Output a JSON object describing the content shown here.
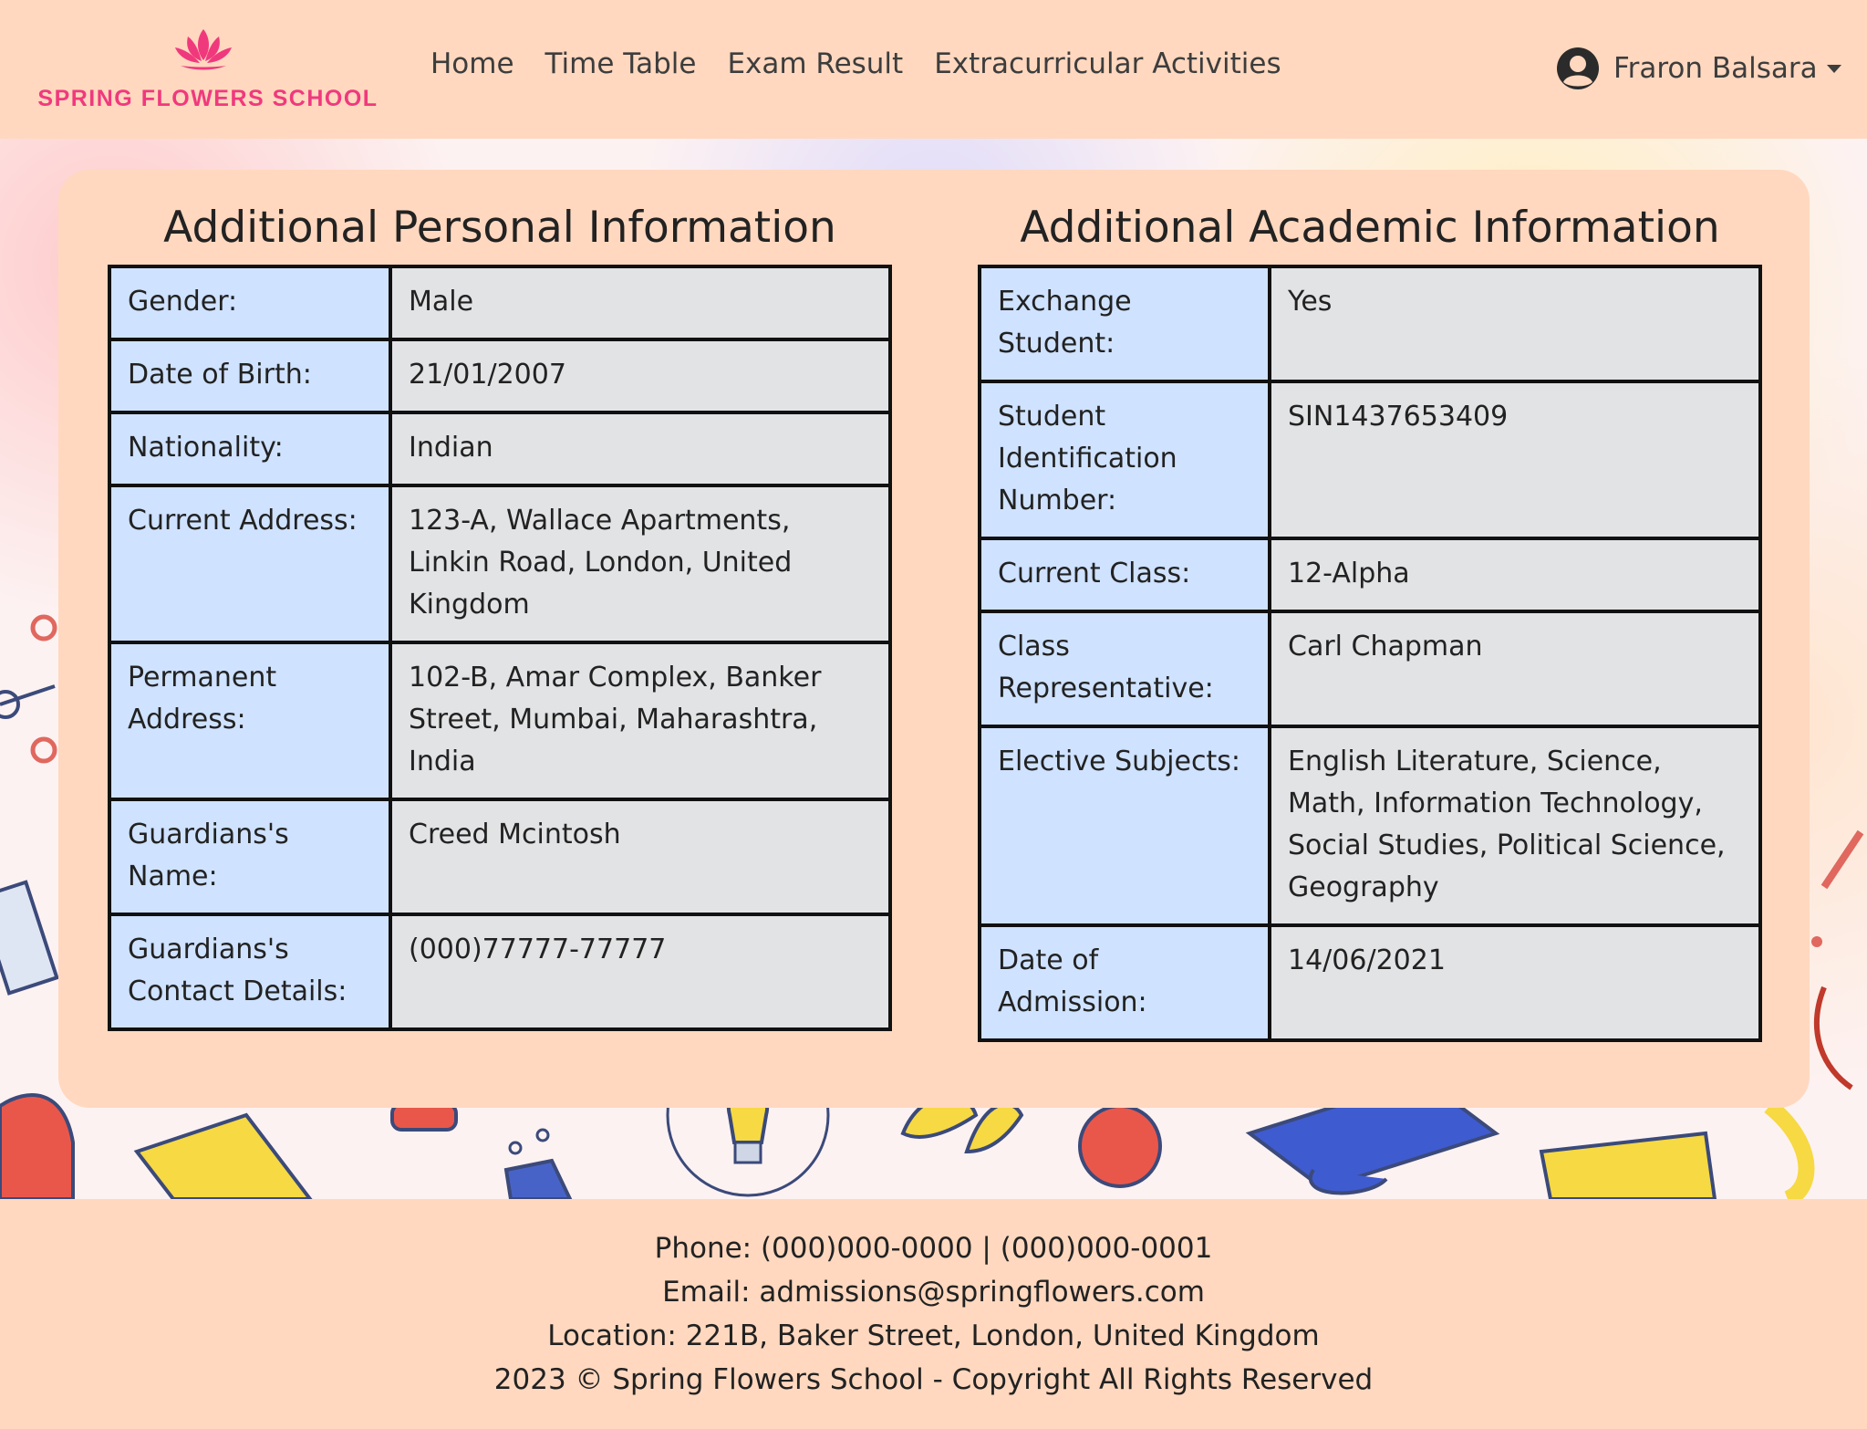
{
  "brand": {
    "name": "SPRING FLOWERS SCHOOL",
    "logo_icon": "lotus-icon",
    "color": "#f0397d"
  },
  "nav": {
    "items": [
      "Home",
      "Time Table",
      "Exam Result",
      "Extracurricular Activities"
    ]
  },
  "user": {
    "name": "Fraron Balsara",
    "icon": "user-avatar-icon"
  },
  "personal": {
    "title": "Additional Personal Information",
    "rows": [
      {
        "label": "Gender:",
        "value": "Male"
      },
      {
        "label": "Date of Birth:",
        "value": "21/01/2007"
      },
      {
        "label": "Nationality:",
        "value": "Indian"
      },
      {
        "label": "Current Address:",
        "value": "123-A, Wallace Apartments, Linkin Road, London, United Kingdom"
      },
      {
        "label": "Permanent Address:",
        "value": "102-B, Amar Complex, Banker Street, Mumbai, Maharashtra, India"
      },
      {
        "label": "Guardians's Name:",
        "value": "Creed Mcintosh"
      },
      {
        "label": "Guardians's Contact Details:",
        "value": "(000)77777-77777"
      }
    ]
  },
  "academic": {
    "title": "Additional Academic Information",
    "rows": [
      {
        "label": "Exchange Student:",
        "value": "Yes"
      },
      {
        "label": "Student Identification Number:",
        "value": "SIN1437653409"
      },
      {
        "label": "Current Class:",
        "value": "12-Alpha"
      },
      {
        "label": "Class Representative:",
        "value": "Carl Chapman"
      },
      {
        "label": "Elective Subjects:",
        "value": "English Literature, Science, Math, Information Technology, Social Studies, Political Science, Geography"
      },
      {
        "label": "Date of Admission:",
        "value": "14/06/2021"
      }
    ]
  },
  "footer": {
    "phone": "Phone: (000)000-0000 | (000)000-0001",
    "email": "Email: admissions@springflowers.com",
    "location": "Location: 221B, Baker Street, London, United Kingdom",
    "copyright": "2023 © Spring Flowers School - Copyright All Rights Reserved"
  }
}
